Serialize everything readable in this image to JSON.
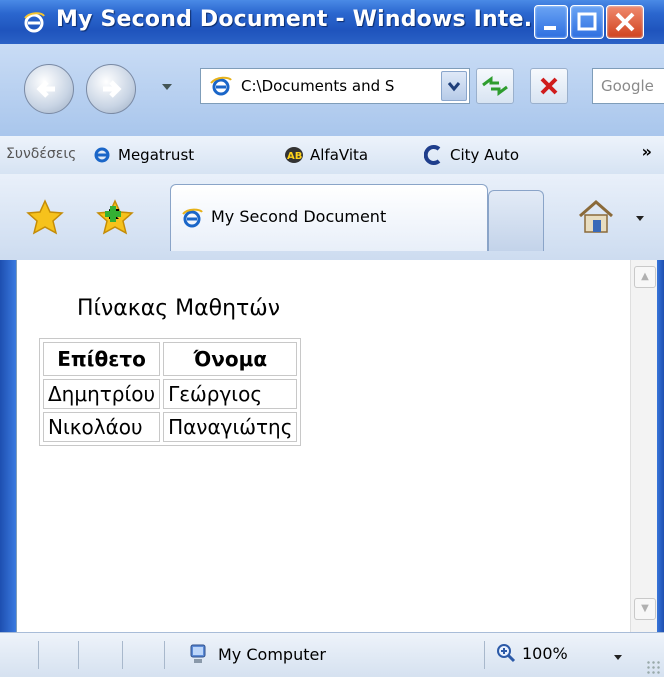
{
  "window": {
    "title": "My Second Document - Windows Inte...",
    "controls": {
      "minimize": "minimize",
      "maximize": "maximize",
      "close": "close"
    }
  },
  "address_bar": {
    "url": "C:\\Documents and S",
    "search_placeholder": "Google"
  },
  "links_bar": {
    "label": "Συνδέσεις",
    "items": [
      {
        "label": "Megatrust",
        "icon": "ie-icon"
      },
      {
        "label": "AlfaVita",
        "icon": "ab-icon"
      },
      {
        "label": "City Auto",
        "icon": "c-icon"
      }
    ],
    "overflow": "»"
  },
  "tabs": [
    {
      "label": "My Second Document",
      "active": true
    }
  ],
  "content": {
    "caption": "Πίνακας Μαθητών",
    "headers": [
      "Επίθετο",
      "Όνομα"
    ],
    "rows": [
      [
        "Δημητρίου",
        "Γεώργιος"
      ],
      [
        "Νικολάου",
        "Παναγιώτης"
      ]
    ]
  },
  "status_bar": {
    "zone": "My Computer",
    "zoom": "100%"
  },
  "colors": {
    "titlebar": "#2b67cf",
    "close_button": "#d0421e",
    "content_bg": "#ffffff"
  }
}
